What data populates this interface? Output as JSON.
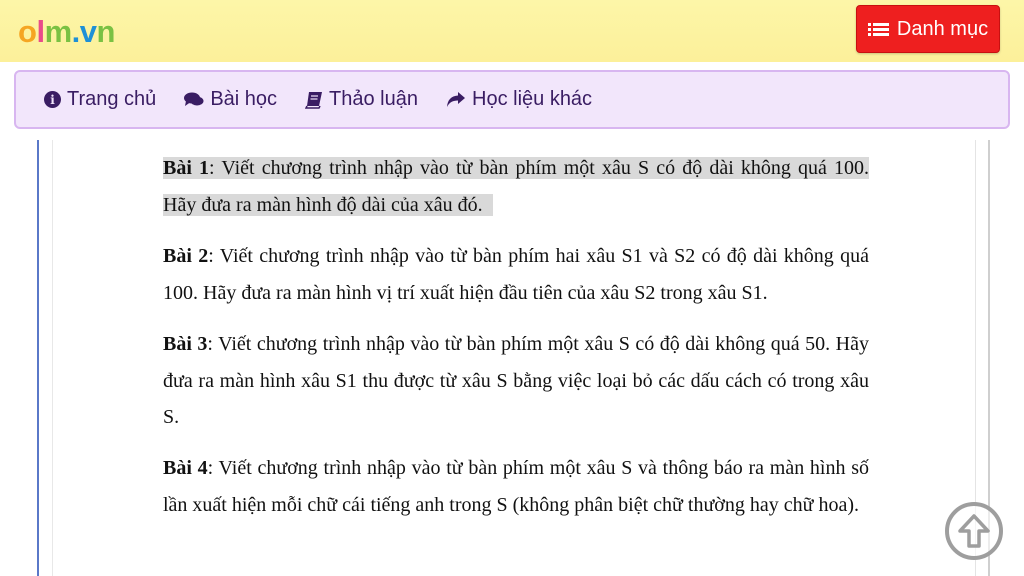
{
  "header": {
    "logo": "olm.vn",
    "menu_button": "Danh mục",
    "menu_icon": "list-icon"
  },
  "nav": {
    "items": [
      {
        "label": "Trang chủ",
        "icon": "info-circle-icon"
      },
      {
        "label": "Bài học",
        "icon": "comments-icon"
      },
      {
        "label": "Thảo luận",
        "icon": "book-icon"
      },
      {
        "label": "Học liệu khác",
        "icon": "share-icon"
      }
    ]
  },
  "document": {
    "exercises": [
      {
        "title": "Bài 1",
        "text": ": Viết chương trình nhập vào từ bàn phím một xâu S có độ dài không quá 100. Hãy đưa ra màn hình độ dài của xâu đó."
      },
      {
        "title": "Bài 2",
        "text": ": Viết chương trình nhập vào từ bàn phím hai xâu S1 và S2  có độ dài không quá 100. Hãy đưa ra màn hình vị trí xuất hiện đầu tiên của xâu S2 trong xâu S1."
      },
      {
        "title": "Bài 3",
        "text": ": Viết chương trình nhập vào từ bàn phím một xâu S có độ dài không quá 50. Hãy đưa ra màn hình xâu S1 thu  được từ xâu S bằng việc loại bỏ các dấu cách có trong xâu S."
      },
      {
        "title": "Bài 4",
        "text": ": Viết chương trình nhập vào từ bàn phím một xâu S và thông báo ra màn hình số lần xuất hiện mỗi chữ cái tiếng anh trong S (không phân biệt chữ thường hay chữ hoa)."
      }
    ]
  },
  "colors": {
    "topbar": "#fcf09a",
    "menu_button": "#ee1f1f",
    "navbar_bg": "#f2e6fb",
    "navbar_text": "#3a1d63",
    "highlight": "#d9d9d9"
  },
  "scroll_top_icon": "arrow-up-circle-icon"
}
